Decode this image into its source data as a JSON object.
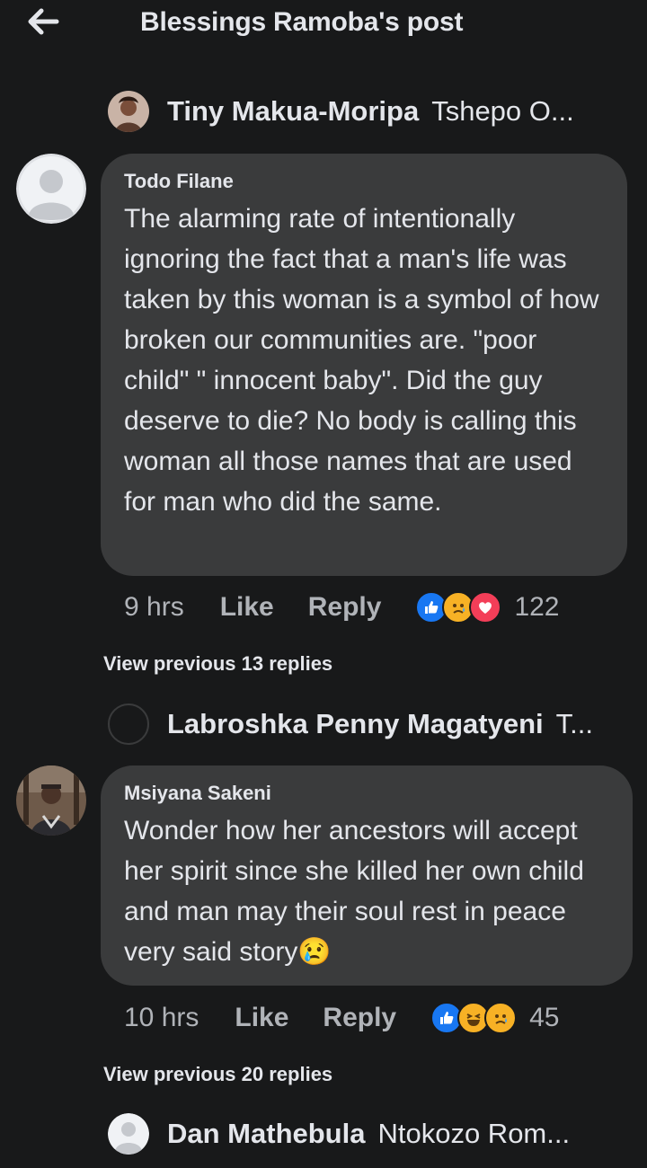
{
  "header": {
    "title": "Blessings Ramoba's post"
  },
  "threads": [
    {
      "top_reply": {
        "name": "Tiny Makua-Moripa",
        "snippet": "Tshepo O..."
      },
      "comment": {
        "author": "Todo Filane",
        "text": "The alarming rate of intentionally ignoring the fact that a man's life was taken by this woman is a symbol of how broken our communities are. \"poor child\" \" innocent baby\". Did the guy deserve to die? No body is calling this woman all those names that are used for man who did the same.",
        "time": "9 hrs",
        "like_label": "Like",
        "reply_label": "Reply",
        "reactions": [
          "like-icon",
          "sad-icon",
          "love-icon"
        ],
        "reaction_count": "122"
      },
      "view_previous": "View previous 13 replies"
    },
    {
      "top_reply": {
        "name": "Labroshka Penny Magatyeni",
        "snippet": "T..."
      },
      "comment": {
        "author": "Msiyana Sakeni",
        "text": "Wonder how her ancestors will accept her spirit since she killed her own child and man may their soul rest in peace very said story",
        "emoji": "😢",
        "time": "10 hrs",
        "like_label": "Like",
        "reply_label": "Reply",
        "reactions": [
          "like-icon",
          "haha-icon",
          "sad-icon"
        ],
        "reaction_count": "45"
      },
      "view_previous": "View previous 20 replies"
    },
    {
      "top_reply": {
        "name": "Dan Mathebula",
        "snippet": "Ntokozo Rom..."
      }
    }
  ],
  "colors": {
    "background": "#18191a",
    "bubble": "#3a3b3c",
    "text": "#e4e6eb",
    "muted": "#b0b3b8",
    "like_blue": "#1877f2",
    "love_red": "#f33e58",
    "reaction_yellow": "#f7b125"
  }
}
